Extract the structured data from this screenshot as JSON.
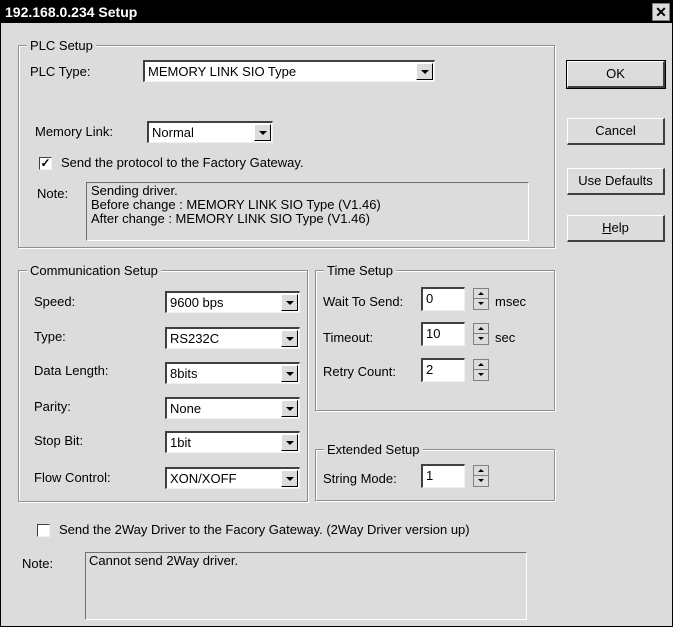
{
  "window": {
    "title": "192.168.0.234 Setup",
    "close_symbol": "✕"
  },
  "plc_setup": {
    "legend": "PLC Setup",
    "plc_type_label": "PLC Type:",
    "plc_type_value": "MEMORY LINK SIO Type",
    "memory_link_label": "Memory Link:",
    "memory_link_value": "Normal",
    "send_protocol_checked": true,
    "send_protocol_label": "Send the protocol to the Factory Gateway.",
    "note_label": "Note:",
    "note_lines": [
      "Sending driver.",
      "Before change : MEMORY LINK SIO Type (V1.46)",
      "After change : MEMORY LINK SIO Type (V1.46)"
    ]
  },
  "communication_setup": {
    "legend": "Communication Setup",
    "fields": [
      {
        "label": "Speed:",
        "value": "9600 bps"
      },
      {
        "label": "Type:",
        "value": "RS232C"
      },
      {
        "label": "Data Length:",
        "value": "8bits"
      },
      {
        "label": "Parity:",
        "value": "None"
      },
      {
        "label": "Stop Bit:",
        "value": "1bit"
      },
      {
        "label": "Flow Control:",
        "value": "XON/XOFF"
      }
    ]
  },
  "time_setup": {
    "legend": "Time Setup",
    "fields": [
      {
        "label": "Wait To Send:",
        "value": "0",
        "unit": "msec"
      },
      {
        "label": "Timeout:",
        "value": "10",
        "unit": "sec"
      },
      {
        "label": "Retry Count:",
        "value": "2",
        "unit": ""
      }
    ]
  },
  "extended_setup": {
    "legend": "Extended Setup",
    "string_mode_label": "String Mode:",
    "string_mode_value": "1"
  },
  "two_way": {
    "checked": false,
    "label": "Send the 2Way Driver to the Facory Gateway. (2Way Driver version up)",
    "note_label": "Note:",
    "note_text": "Cannot send 2Way driver."
  },
  "buttons": {
    "ok": "OK",
    "cancel": "Cancel",
    "use_defaults": "Use Defaults",
    "help_mnemonic": "H",
    "help_rest": "elp"
  }
}
